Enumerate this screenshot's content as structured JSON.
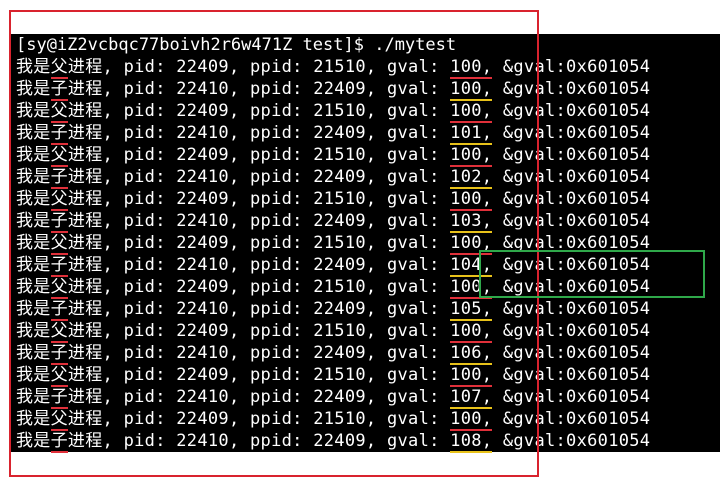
{
  "terminal": {
    "prompt": "[sy@iZ2vcbqc77boivh2r6w471Z test]$ ./mytest",
    "lines": [
      {
        "who": "父",
        "pid": "22409",
        "ppid": "21510",
        "gval": "100"
      },
      {
        "who": "子",
        "pid": "22410",
        "ppid": "22409",
        "gval": "100"
      },
      {
        "who": "父",
        "pid": "22409",
        "ppid": "21510",
        "gval": "100"
      },
      {
        "who": "子",
        "pid": "22410",
        "ppid": "22409",
        "gval": "101"
      },
      {
        "who": "父",
        "pid": "22409",
        "ppid": "21510",
        "gval": "100"
      },
      {
        "who": "子",
        "pid": "22410",
        "ppid": "22409",
        "gval": "102"
      },
      {
        "who": "父",
        "pid": "22409",
        "ppid": "21510",
        "gval": "100"
      },
      {
        "who": "子",
        "pid": "22410",
        "ppid": "22409",
        "gval": "103"
      },
      {
        "who": "父",
        "pid": "22409",
        "ppid": "21510",
        "gval": "100"
      },
      {
        "who": "子",
        "pid": "22410",
        "ppid": "22409",
        "gval": "104"
      },
      {
        "who": "父",
        "pid": "22409",
        "ppid": "21510",
        "gval": "100"
      },
      {
        "who": "子",
        "pid": "22410",
        "ppid": "22409",
        "gval": "105"
      },
      {
        "who": "父",
        "pid": "22409",
        "ppid": "21510",
        "gval": "100"
      },
      {
        "who": "子",
        "pid": "22410",
        "ppid": "22409",
        "gval": "106"
      },
      {
        "who": "父",
        "pid": "22409",
        "ppid": "21510",
        "gval": "100"
      },
      {
        "who": "子",
        "pid": "22410",
        "ppid": "22409",
        "gval": "107"
      },
      {
        "who": "父",
        "pid": "22409",
        "ppid": "21510",
        "gval": "100"
      },
      {
        "who": "子",
        "pid": "22410",
        "ppid": "22409",
        "gval": "108"
      }
    ],
    "prefix": "我是",
    "suffix": "进程",
    "addr": "0x601054"
  },
  "colors": {
    "terminal_bg": "#000000",
    "text": "#ffffff",
    "red_annotation": "#d9232e",
    "green_annotation": "#2fa84a",
    "yellow_underline": "#e8c21a"
  }
}
